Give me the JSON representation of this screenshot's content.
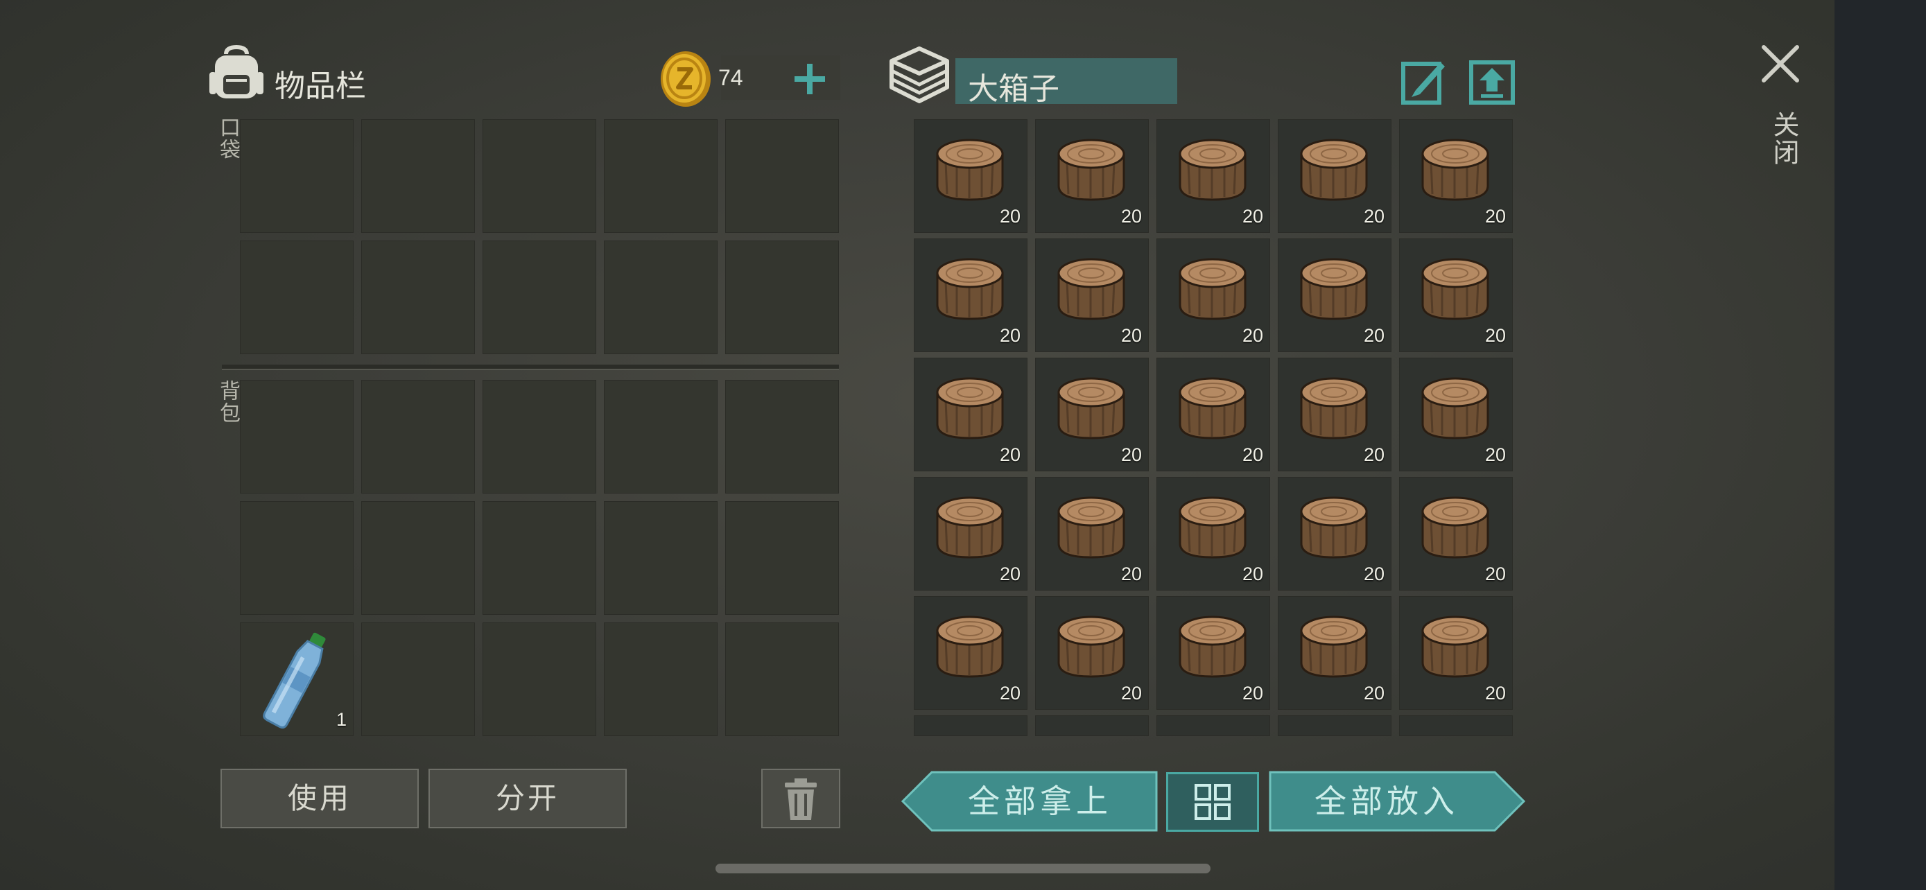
{
  "inventory": {
    "title": "物品栏",
    "coins": "74",
    "pocket_label": "口袋",
    "backpack_label": "背包",
    "bottle_count": "1"
  },
  "chest": {
    "title": "大箱子",
    "log_count": "20",
    "item_icon": "wood-log-icon"
  },
  "buttons": {
    "use": "使用",
    "split": "分开",
    "take_all": "全部拿上",
    "put_all": "全部放入"
  },
  "close_label": "关闭",
  "colors": {
    "teal": "#3f8d8b",
    "teal_light": "#6fc2bd",
    "slot": "#34362f",
    "coin": "#d9a520"
  }
}
